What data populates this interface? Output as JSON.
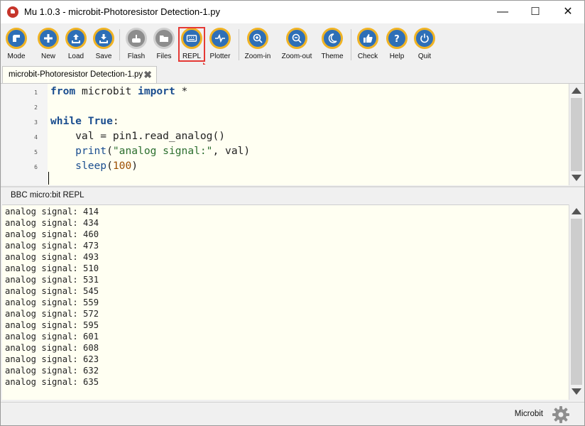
{
  "window": {
    "title": "Mu 1.0.3 - microbit-Photoresistor Detection-1.py",
    "minimize": "—",
    "maximize": "☐",
    "close": "✕"
  },
  "toolbar": {
    "mode": "Mode",
    "new": "New",
    "load": "Load",
    "save": "Save",
    "flash": "Flash",
    "files": "Files",
    "repl": "REPL",
    "plotter": "Plotter",
    "zoom_in": "Zoom-in",
    "zoom_out": "Zoom-out",
    "theme": "Theme",
    "check": "Check",
    "help": "Help",
    "quit": "Quit"
  },
  "tab": {
    "label": "microbit-Photoresistor Detection-1.py",
    "close": "✖"
  },
  "editor": {
    "line_numbers": [
      "1",
      "2",
      "3",
      "4",
      "5",
      "6"
    ],
    "code": {
      "l1_from": "from",
      "l1_module": " microbit ",
      "l1_import": "import",
      "l1_star": " *",
      "l3_while": "while",
      "l3_true": " True",
      "l3_colon": ":",
      "l4": "    val = pin1.read_analog()",
      "l5_indent": "    ",
      "l5_print": "print",
      "l5_open": "(",
      "l5_str": "\"analog signal:\"",
      "l5_rest": ", val)",
      "l6_indent": "    ",
      "l6_sleep": "sleep",
      "l6_open": "(",
      "l6_num": "100",
      "l6_close": ")"
    }
  },
  "repl": {
    "title": "BBC micro:bit REPL",
    "lines": [
      "analog signal: 414",
      "analog signal: 434",
      "analog signal: 460",
      "analog signal: 473",
      "analog signal: 493",
      "analog signal: 510",
      "analog signal: 531",
      "analog signal: 545",
      "analog signal: 559",
      "analog signal: 572",
      "analog signal: 595",
      "analog signal: 601",
      "analog signal: 608",
      "analog signal: 623",
      "analog signal: 632",
      "analog signal: 635"
    ]
  },
  "status": {
    "mode": "Microbit"
  },
  "colors": {
    "accent_ring": "#f0b324",
    "button_fill": "#2e6fb7",
    "highlight": "#e53935"
  }
}
